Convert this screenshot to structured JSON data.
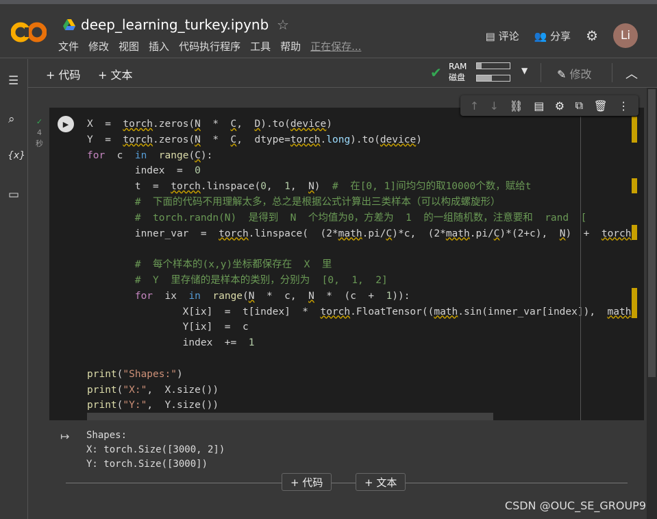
{
  "header": {
    "title": "deep_learning_turkey.ipynb",
    "menu": [
      "文件",
      "修改",
      "视图",
      "插入",
      "代码执行程序",
      "工具",
      "帮助"
    ],
    "saving": "正在保存...",
    "comment": "评论",
    "share": "分享",
    "avatar": "Li"
  },
  "toolbar": {
    "add_code": "+ 代码",
    "add_text": "+ 文本",
    "ram": "RAM",
    "disk": "磁盘",
    "ram_usage": 0.15,
    "disk_usage": 0.45,
    "edit": "修改"
  },
  "cell": {
    "exec_time": "4",
    "exec_unit": "秒",
    "code": [
      [
        [
          "X  =  ",
          ""
        ],
        [
          "torch",
          "w"
        ],
        [
          ".zeros(",
          ""
        ],
        [
          "N",
          "w"
        ],
        [
          "  *  ",
          ""
        ],
        [
          "C",
          "w"
        ],
        [
          ",  ",
          ""
        ],
        [
          "D",
          "w"
        ],
        [
          ").to(",
          ""
        ],
        [
          "device",
          "w"
        ],
        [
          ")",
          ""
        ]
      ],
      [
        [
          "Y  =  ",
          ""
        ],
        [
          "torch",
          "w"
        ],
        [
          ".zeros(",
          ""
        ],
        [
          "N",
          "w"
        ],
        [
          "  *  ",
          ""
        ],
        [
          "C",
          "w"
        ],
        [
          ",  dtype=",
          ""
        ],
        [
          "torch",
          "w"
        ],
        [
          ".",
          ""
        ],
        [
          "long",
          "t"
        ],
        [
          ").to(",
          ""
        ],
        [
          "device",
          "w"
        ],
        [
          ")",
          ""
        ]
      ],
      [
        [
          "for",
          "k"
        ],
        [
          "  c  ",
          ""
        ],
        [
          "in",
          "b"
        ],
        [
          "  ",
          ""
        ],
        [
          "range",
          "f"
        ],
        [
          "(",
          ""
        ],
        [
          "C",
          "w"
        ],
        [
          "):",
          ""
        ]
      ],
      [
        [
          "        index  =  ",
          ""
        ],
        [
          "0",
          "n"
        ]
      ],
      [
        [
          "        t  =  ",
          ""
        ],
        [
          "torch",
          "w"
        ],
        [
          ".linspace(",
          ""
        ],
        [
          "0",
          "n"
        ],
        [
          ",  ",
          ""
        ],
        [
          "1",
          "n"
        ],
        [
          ",  ",
          ""
        ],
        [
          "N",
          "w"
        ],
        [
          ")  ",
          ""
        ],
        [
          "#  在[0, 1]间均匀的取10000个数，赋给t",
          "c"
        ]
      ],
      [
        [
          "        ",
          ""
        ],
        [
          "#  下面的代码不用理解太多，总之是根据公式计算出三类样本（可以构成螺旋形）",
          "c"
        ]
      ],
      [
        [
          "        ",
          ""
        ],
        [
          "#  torch.randn(N)  是得到  N  个均值为0，方差为  1  的一组随机数，注意要和  rand  [",
          "c"
        ]
      ],
      [
        [
          "        inner_var  =  ",
          ""
        ],
        [
          "torch",
          "w"
        ],
        [
          ".linspace(  (2*",
          ""
        ],
        [
          "math",
          "w"
        ],
        [
          ".pi/",
          ""
        ],
        [
          "C",
          "w"
        ],
        [
          ")*c,  (2*",
          ""
        ],
        [
          "math",
          "w"
        ],
        [
          ".pi/",
          ""
        ],
        [
          "C",
          "w"
        ],
        [
          ")*(2+c),  ",
          ""
        ],
        [
          "N",
          "w"
        ],
        [
          ")  +  ",
          ""
        ],
        [
          "torch",
          "w"
        ]
      ],
      [
        [
          "",
          ""
        ]
      ],
      [
        [
          "        ",
          ""
        ],
        [
          "#  每个样本的(x,y)坐标都保存在  X  里",
          "c"
        ]
      ],
      [
        [
          "        ",
          ""
        ],
        [
          "#  Y  里存储的是样本的类别，分别为  [0,  1,  2]",
          "c"
        ]
      ],
      [
        [
          "        ",
          ""
        ],
        [
          "for",
          "k"
        ],
        [
          "  ix  ",
          ""
        ],
        [
          "in",
          "b"
        ],
        [
          "  ",
          ""
        ],
        [
          "range",
          "f"
        ],
        [
          "(",
          ""
        ],
        [
          "N",
          "w"
        ],
        [
          "  *  c,  ",
          ""
        ],
        [
          "N",
          "w"
        ],
        [
          "  *  (c  +  ",
          ""
        ],
        [
          "1",
          "n"
        ],
        [
          ")):",
          ""
        ]
      ],
      [
        [
          "                X[ix]  =  t[index]  *  ",
          ""
        ],
        [
          "torch",
          "w"
        ],
        [
          ".FloatTensor((",
          ""
        ],
        [
          "math",
          "w"
        ],
        [
          ".sin(inner_var[index]),  ",
          ""
        ],
        [
          "math",
          "w"
        ]
      ],
      [
        [
          "                Y[ix]  =  c",
          ""
        ]
      ],
      [
        [
          "                index  +=  ",
          ""
        ],
        [
          "1",
          "n"
        ]
      ],
      [
        [
          "",
          ""
        ]
      ],
      [
        [
          "print",
          "f"
        ],
        [
          "(",
          ""
        ],
        [
          "\"Shapes:\"",
          "s"
        ],
        [
          ")",
          ""
        ]
      ],
      [
        [
          "print",
          "f"
        ],
        [
          "(",
          ""
        ],
        [
          "\"X:\"",
          "s"
        ],
        [
          ",  X.size())",
          ""
        ]
      ],
      [
        [
          "print",
          "f"
        ],
        [
          "(",
          ""
        ],
        [
          "\"Y:\"",
          "s"
        ],
        [
          ",  Y.size())",
          ""
        ]
      ]
    ],
    "output": "Shapes:\nX: torch.Size([3000, 2])\nY: torch.Size([3000])"
  },
  "add_bar": {
    "code": "+  代码",
    "text": "+  文本"
  },
  "watermark": "CSDN @OUC_SE_GROUP9",
  "colors": {
    "accent_orange": "#f9ab00",
    "check": "#34a853",
    "warning_mark": "#c8a000"
  }
}
